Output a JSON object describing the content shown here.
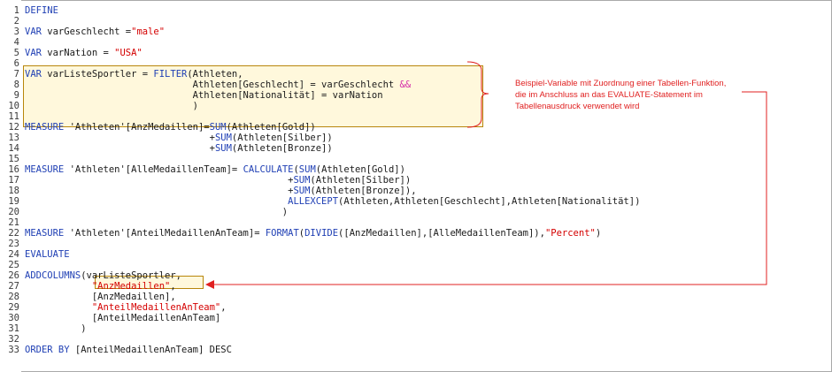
{
  "editor": {
    "lines": [
      {
        "n": "1",
        "tokens": [
          {
            "t": "DEFINE",
            "c": "kw"
          }
        ]
      },
      {
        "n": "2",
        "tokens": []
      },
      {
        "n": "3",
        "tokens": [
          {
            "t": "VAR",
            "c": "kw"
          },
          {
            "t": " varGeschlecht =",
            "c": ""
          },
          {
            "t": "\"male\"",
            "c": "str"
          }
        ]
      },
      {
        "n": "4",
        "tokens": []
      },
      {
        "n": "5",
        "tokens": [
          {
            "t": "VAR",
            "c": "kw"
          },
          {
            "t": " varNation = ",
            "c": ""
          },
          {
            "t": "\"USA\"",
            "c": "str"
          }
        ]
      },
      {
        "n": "6",
        "tokens": []
      },
      {
        "n": "7",
        "tokens": [
          {
            "t": "VAR",
            "c": "kw"
          },
          {
            "t": " varListeSportler = ",
            "c": ""
          },
          {
            "t": "FILTER",
            "c": "kw"
          },
          {
            "t": "(Athleten,",
            "c": ""
          }
        ]
      },
      {
        "n": "8",
        "tokens": [
          {
            "t": "                              Athleten[Geschlecht] = varGeschlecht ",
            "c": ""
          },
          {
            "t": "&&",
            "c": "op"
          }
        ]
      },
      {
        "n": "9",
        "tokens": [
          {
            "t": "                              Athleten[Nationalität] = varNation",
            "c": ""
          }
        ]
      },
      {
        "n": "10",
        "tokens": [
          {
            "t": "                              )",
            "c": ""
          }
        ]
      },
      {
        "n": "11",
        "tokens": []
      },
      {
        "n": "12",
        "tokens": [
          {
            "t": "MEASURE",
            "c": "kw"
          },
          {
            "t": " 'Athleten'[AnzMedaillen]=",
            "c": ""
          },
          {
            "t": "SUM",
            "c": "kw"
          },
          {
            "t": "(Athleten[Gold])",
            "c": ""
          }
        ]
      },
      {
        "n": "13",
        "tokens": [
          {
            "t": "                                 +",
            "c": ""
          },
          {
            "t": "SUM",
            "c": "kw"
          },
          {
            "t": "(Athleten[Silber])",
            "c": ""
          }
        ]
      },
      {
        "n": "14",
        "tokens": [
          {
            "t": "                                 +",
            "c": ""
          },
          {
            "t": "SUM",
            "c": "kw"
          },
          {
            "t": "(Athleten[Bronze])",
            "c": ""
          }
        ]
      },
      {
        "n": "15",
        "tokens": []
      },
      {
        "n": "16",
        "tokens": [
          {
            "t": "MEASURE",
            "c": "kw"
          },
          {
            "t": " 'Athleten'[AlleMedaillenTeam]= ",
            "c": ""
          },
          {
            "t": "CALCULATE",
            "c": "kw"
          },
          {
            "t": "(",
            "c": ""
          },
          {
            "t": "SUM",
            "c": "kw"
          },
          {
            "t": "(Athleten[Gold])",
            "c": ""
          }
        ]
      },
      {
        "n": "17",
        "tokens": [
          {
            "t": "                                               +",
            "c": ""
          },
          {
            "t": "SUM",
            "c": "kw"
          },
          {
            "t": "(Athleten[Silber])",
            "c": ""
          }
        ]
      },
      {
        "n": "18",
        "tokens": [
          {
            "t": "                                               +",
            "c": ""
          },
          {
            "t": "SUM",
            "c": "kw"
          },
          {
            "t": "(Athleten[Bronze]),",
            "c": ""
          }
        ]
      },
      {
        "n": "19",
        "tokens": [
          {
            "t": "                                               ",
            "c": ""
          },
          {
            "t": "ALLEXCEPT",
            "c": "kw"
          },
          {
            "t": "(Athleten,Athleten[Geschlecht],Athleten[Nationalität])",
            "c": ""
          }
        ]
      },
      {
        "n": "20",
        "tokens": [
          {
            "t": "                                              )",
            "c": ""
          }
        ]
      },
      {
        "n": "21",
        "tokens": []
      },
      {
        "n": "22",
        "tokens": [
          {
            "t": "MEASURE",
            "c": "kw"
          },
          {
            "t": " 'Athleten'[AnteilMedaillenAnTeam]= ",
            "c": ""
          },
          {
            "t": "FORMAT",
            "c": "kw"
          },
          {
            "t": "(",
            "c": ""
          },
          {
            "t": "DIVIDE",
            "c": "kw"
          },
          {
            "t": "([AnzMedaillen],[AlleMedaillenTeam]),",
            "c": ""
          },
          {
            "t": "\"Percent\"",
            "c": "str"
          },
          {
            "t": ")",
            "c": ""
          }
        ]
      },
      {
        "n": "23",
        "tokens": []
      },
      {
        "n": "24",
        "tokens": [
          {
            "t": "EVALUATE",
            "c": "kw"
          }
        ]
      },
      {
        "n": "25",
        "tokens": []
      },
      {
        "n": "26",
        "tokens": [
          {
            "t": "ADDCOLUMNS",
            "c": "kw"
          },
          {
            "t": "(varListeSportler,",
            "c": ""
          }
        ]
      },
      {
        "n": "27",
        "tokens": [
          {
            "t": "            ",
            "c": ""
          },
          {
            "t": "\"AnzMedaillen\"",
            "c": "str"
          },
          {
            "t": ",",
            "c": ""
          }
        ]
      },
      {
        "n": "28",
        "tokens": [
          {
            "t": "            [AnzMedaillen],",
            "c": ""
          }
        ]
      },
      {
        "n": "29",
        "tokens": [
          {
            "t": "            ",
            "c": ""
          },
          {
            "t": "\"AnteilMedaillenAnTeam\"",
            "c": "str"
          },
          {
            "t": ",",
            "c": ""
          }
        ]
      },
      {
        "n": "30",
        "tokens": [
          {
            "t": "            [AnteilMedaillenAnTeam]",
            "c": ""
          }
        ]
      },
      {
        "n": "31",
        "tokens": [
          {
            "t": "          )",
            "c": ""
          }
        ]
      },
      {
        "n": "32",
        "tokens": []
      },
      {
        "n": "33",
        "tokens": [
          {
            "t": "ORDER BY",
            "c": "kw"
          },
          {
            "t": " [AnteilMedaillenAnTeam] DESC",
            "c": ""
          }
        ]
      }
    ]
  },
  "annotation": {
    "text": "Beispiel-Variable mit Zuordnung einer Tabellen-Funktion, die im Anschluss an das EVALUATE-Statement im Tabellenausdruck verwendet wird"
  },
  "colors": {
    "keyword": "#1f3fb4",
    "string": "#d40000",
    "operator": "#d42aa8",
    "annotation": "#e02020",
    "highlight_bg": "#fff8dc"
  }
}
